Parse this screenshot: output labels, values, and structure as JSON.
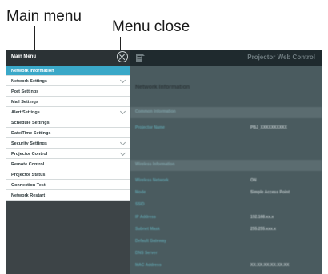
{
  "annotations": {
    "main_menu": "Main menu",
    "menu_close": "Menu close"
  },
  "header": {
    "title": "Projector Web Control"
  },
  "sidebar": {
    "title": "Main Menu",
    "items": [
      {
        "label": "Network Information",
        "active": true,
        "expandable": false
      },
      {
        "label": "Network Settings",
        "active": false,
        "expandable": true
      },
      {
        "label": "Port Settings",
        "active": false,
        "expandable": false
      },
      {
        "label": "Mail Settings",
        "active": false,
        "expandable": false
      },
      {
        "label": "Alert Settings",
        "active": false,
        "expandable": true
      },
      {
        "label": "Schedule Settings",
        "active": false,
        "expandable": false
      },
      {
        "label": "Date/Time Settings",
        "active": false,
        "expandable": false
      },
      {
        "label": "Security Settings",
        "active": false,
        "expandable": true
      },
      {
        "label": "Projector Control",
        "active": false,
        "expandable": true
      },
      {
        "label": "Remote Control",
        "active": false,
        "expandable": false
      },
      {
        "label": "Projector Status",
        "active": false,
        "expandable": false
      },
      {
        "label": "Connection Test",
        "active": false,
        "expandable": false
      },
      {
        "label": "Network Restart",
        "active": false,
        "expandable": false
      }
    ]
  },
  "content": {
    "heading": "Network Information",
    "common_section": "Common Information",
    "projector_name_label": "Projector Name",
    "projector_name_value": "PBJ_XXXXXXXXXX",
    "wireless_section": "Wireless Information",
    "wireless_rows": [
      {
        "label": "Wireless Network",
        "value": "ON"
      },
      {
        "label": "Mode",
        "value": "Simple Access Point"
      },
      {
        "label": "SSID",
        "value": ""
      },
      {
        "label": "IP Address",
        "value": "192.168.xx.x"
      },
      {
        "label": "Subnet Mask",
        "value": "255.255.xxx.x"
      },
      {
        "label": "Default Gateway",
        "value": ""
      },
      {
        "label": "DNS Server",
        "value": ""
      },
      {
        "label": "MAC Address",
        "value": "XX:XX:XX:XX:XX:XX"
      }
    ]
  },
  "colors": {
    "active_item": "#3aa8c8",
    "sidebar_header": "#2b3235",
    "topbar": "#1f2a2e",
    "content_bg": "#4a5b5f"
  }
}
